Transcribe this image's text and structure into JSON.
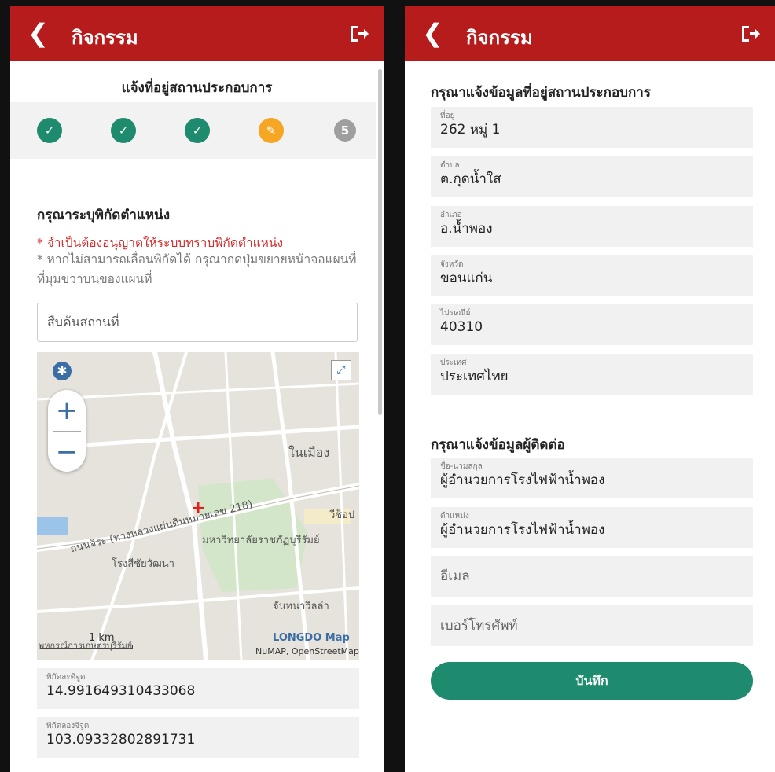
{
  "app": {
    "title": "กิจกรรม"
  },
  "left": {
    "subtitle": "แจ้งที่อยู่สถานประกอบการ",
    "steps": [
      {
        "state": "done"
      },
      {
        "state": "done"
      },
      {
        "state": "done"
      },
      {
        "state": "active"
      },
      {
        "state": "todo",
        "label": "5"
      }
    ],
    "section_title": "กรุณาระบุพิกัดตำแหน่ง",
    "warning": "* จำเป็นต้องอนุญาตให้ระบบทราบพิกัดตำแหน่ง",
    "note": "* หากไม่สามารถเลื่อนพิกัดได้ กรุณากดปุ่มขยายหน้าจอแผนที่ที่มุมขวาบนของแผนที่",
    "search_placeholder": "สืบค้นสถานที่",
    "map": {
      "labels": {
        "district": "ในเมือง",
        "road": "ถนนจิระ (ทางหลวงแผ่นดินหมายเลข 218)",
        "university": "มหาวิทยาลัยราชภัฏบุรีรัมย์",
        "school": "โรงสีชัยวัฒนา",
        "place1": "จันทนาวิลล่า",
        "place2": "วีช็อป",
        "scale": "1 km",
        "bottom_left": "พหกรณ์การเกษตรบุรีรัมย์",
        "brand": "LONGDO Map",
        "attribution": "NuMAP, OpenStreetMap"
      }
    },
    "latitude": {
      "label": "พิกัดละติจูด",
      "value": "14.991649310433068"
    },
    "longitude": {
      "label": "พิกัดลองจิจูด",
      "value": "103.09332802891731"
    }
  },
  "right": {
    "address_title": "กรุณาแจ้งข้อมูลที่อยู่สถานประกอบการ",
    "address_fields": [
      {
        "label": "ที่อยู่",
        "value": "262 หมู่ 1"
      },
      {
        "label": "ตำบล",
        "value": "ต.กุดน้ำใส"
      },
      {
        "label": "อำเภอ",
        "value": "อ.น้ำพอง"
      },
      {
        "label": "จังหวัด",
        "value": "ขอนแก่น"
      },
      {
        "label": "ไปรษณีย์",
        "value": "40310"
      },
      {
        "label": "ประเทศ",
        "value": "ประเทศไทย"
      }
    ],
    "contact_title": "กรุณาแจ้งข้อมูลผู้ติดต่อ",
    "contact_fields": [
      {
        "label": "ชื่อ-นามสกุล",
        "value": "ผู้อำนวยการโรงไฟฟ้าน้ำพอง"
      },
      {
        "label": "ตำแหน่ง",
        "value": "ผู้อำนวยการโรงไฟฟ้าน้ำพอง"
      }
    ],
    "email_placeholder": "อีเมล",
    "phone_placeholder": "เบอร์โทรศัพท์",
    "save_label": "บันทึก"
  },
  "colors": {
    "header": "#b71c1c",
    "primary": "#1e8a6e",
    "active": "#f5a623",
    "warning": "#d32f2f"
  }
}
